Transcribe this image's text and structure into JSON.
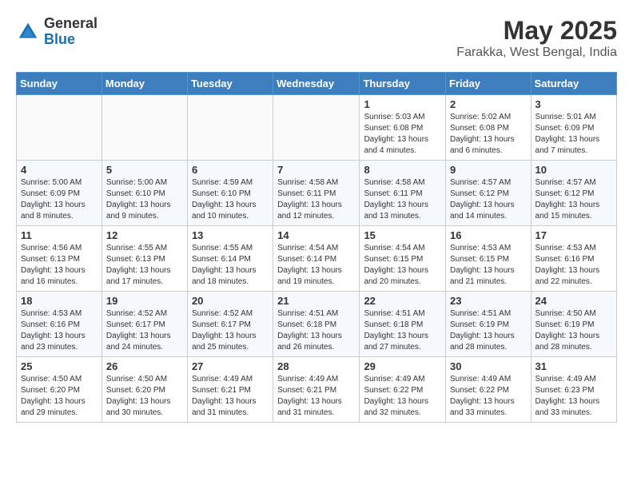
{
  "header": {
    "logo_general": "General",
    "logo_blue": "Blue",
    "month_year": "May 2025",
    "location": "Farakka, West Bengal, India"
  },
  "days_of_week": [
    "Sunday",
    "Monday",
    "Tuesday",
    "Wednesday",
    "Thursday",
    "Friday",
    "Saturday"
  ],
  "weeks": [
    [
      {
        "day": "",
        "info": ""
      },
      {
        "day": "",
        "info": ""
      },
      {
        "day": "",
        "info": ""
      },
      {
        "day": "",
        "info": ""
      },
      {
        "day": "1",
        "info": "Sunrise: 5:03 AM\nSunset: 6:08 PM\nDaylight: 13 hours\nand 4 minutes."
      },
      {
        "day": "2",
        "info": "Sunrise: 5:02 AM\nSunset: 6:08 PM\nDaylight: 13 hours\nand 6 minutes."
      },
      {
        "day": "3",
        "info": "Sunrise: 5:01 AM\nSunset: 6:09 PM\nDaylight: 13 hours\nand 7 minutes."
      }
    ],
    [
      {
        "day": "4",
        "info": "Sunrise: 5:00 AM\nSunset: 6:09 PM\nDaylight: 13 hours\nand 8 minutes."
      },
      {
        "day": "5",
        "info": "Sunrise: 5:00 AM\nSunset: 6:10 PM\nDaylight: 13 hours\nand 9 minutes."
      },
      {
        "day": "6",
        "info": "Sunrise: 4:59 AM\nSunset: 6:10 PM\nDaylight: 13 hours\nand 10 minutes."
      },
      {
        "day": "7",
        "info": "Sunrise: 4:58 AM\nSunset: 6:11 PM\nDaylight: 13 hours\nand 12 minutes."
      },
      {
        "day": "8",
        "info": "Sunrise: 4:58 AM\nSunset: 6:11 PM\nDaylight: 13 hours\nand 13 minutes."
      },
      {
        "day": "9",
        "info": "Sunrise: 4:57 AM\nSunset: 6:12 PM\nDaylight: 13 hours\nand 14 minutes."
      },
      {
        "day": "10",
        "info": "Sunrise: 4:57 AM\nSunset: 6:12 PM\nDaylight: 13 hours\nand 15 minutes."
      }
    ],
    [
      {
        "day": "11",
        "info": "Sunrise: 4:56 AM\nSunset: 6:13 PM\nDaylight: 13 hours\nand 16 minutes."
      },
      {
        "day": "12",
        "info": "Sunrise: 4:55 AM\nSunset: 6:13 PM\nDaylight: 13 hours\nand 17 minutes."
      },
      {
        "day": "13",
        "info": "Sunrise: 4:55 AM\nSunset: 6:14 PM\nDaylight: 13 hours\nand 18 minutes."
      },
      {
        "day": "14",
        "info": "Sunrise: 4:54 AM\nSunset: 6:14 PM\nDaylight: 13 hours\nand 19 minutes."
      },
      {
        "day": "15",
        "info": "Sunrise: 4:54 AM\nSunset: 6:15 PM\nDaylight: 13 hours\nand 20 minutes."
      },
      {
        "day": "16",
        "info": "Sunrise: 4:53 AM\nSunset: 6:15 PM\nDaylight: 13 hours\nand 21 minutes."
      },
      {
        "day": "17",
        "info": "Sunrise: 4:53 AM\nSunset: 6:16 PM\nDaylight: 13 hours\nand 22 minutes."
      }
    ],
    [
      {
        "day": "18",
        "info": "Sunrise: 4:53 AM\nSunset: 6:16 PM\nDaylight: 13 hours\nand 23 minutes."
      },
      {
        "day": "19",
        "info": "Sunrise: 4:52 AM\nSunset: 6:17 PM\nDaylight: 13 hours\nand 24 minutes."
      },
      {
        "day": "20",
        "info": "Sunrise: 4:52 AM\nSunset: 6:17 PM\nDaylight: 13 hours\nand 25 minutes."
      },
      {
        "day": "21",
        "info": "Sunrise: 4:51 AM\nSunset: 6:18 PM\nDaylight: 13 hours\nand 26 minutes."
      },
      {
        "day": "22",
        "info": "Sunrise: 4:51 AM\nSunset: 6:18 PM\nDaylight: 13 hours\nand 27 minutes."
      },
      {
        "day": "23",
        "info": "Sunrise: 4:51 AM\nSunset: 6:19 PM\nDaylight: 13 hours\nand 28 minutes."
      },
      {
        "day": "24",
        "info": "Sunrise: 4:50 AM\nSunset: 6:19 PM\nDaylight: 13 hours\nand 28 minutes."
      }
    ],
    [
      {
        "day": "25",
        "info": "Sunrise: 4:50 AM\nSunset: 6:20 PM\nDaylight: 13 hours\nand 29 minutes."
      },
      {
        "day": "26",
        "info": "Sunrise: 4:50 AM\nSunset: 6:20 PM\nDaylight: 13 hours\nand 30 minutes."
      },
      {
        "day": "27",
        "info": "Sunrise: 4:49 AM\nSunset: 6:21 PM\nDaylight: 13 hours\nand 31 minutes."
      },
      {
        "day": "28",
        "info": "Sunrise: 4:49 AM\nSunset: 6:21 PM\nDaylight: 13 hours\nand 31 minutes."
      },
      {
        "day": "29",
        "info": "Sunrise: 4:49 AM\nSunset: 6:22 PM\nDaylight: 13 hours\nand 32 minutes."
      },
      {
        "day": "30",
        "info": "Sunrise: 4:49 AM\nSunset: 6:22 PM\nDaylight: 13 hours\nand 33 minutes."
      },
      {
        "day": "31",
        "info": "Sunrise: 4:49 AM\nSunset: 6:23 PM\nDaylight: 13 hours\nand 33 minutes."
      }
    ]
  ]
}
